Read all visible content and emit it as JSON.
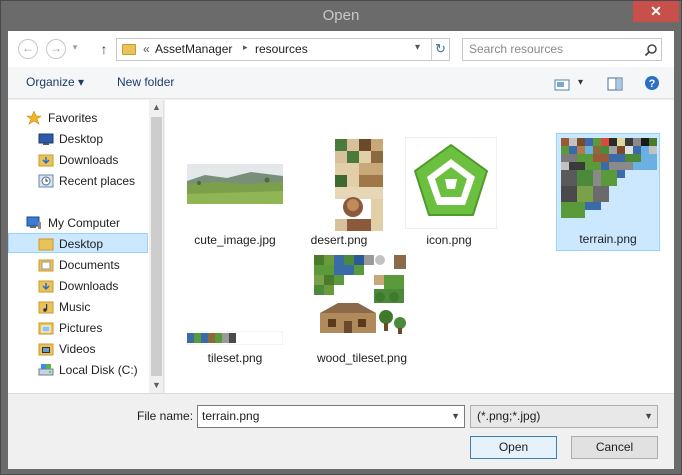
{
  "window": {
    "title": "Open",
    "close_glyph": "✕"
  },
  "nav": {
    "back_glyph": "←",
    "forward_glyph": "→",
    "up_glyph": "↑",
    "breadcrumb": {
      "prefix": "«",
      "parts": [
        "AssetManager",
        "resources"
      ],
      "separator": "▸"
    },
    "refresh_glyph": "↻",
    "search": {
      "placeholder": "Search resources"
    }
  },
  "toolbar": {
    "organize_label": "Organize ▾",
    "new_folder_label": "New folder",
    "view_dropdown": "▾"
  },
  "sidebar": {
    "favorites_label": "Favorites",
    "favorites": [
      "Desktop",
      "Downloads",
      "Recent places"
    ],
    "computer_label": "My Computer",
    "computer": [
      "Desktop",
      "Documents",
      "Downloads",
      "Music",
      "Pictures",
      "Videos",
      "Local Disk (C:)"
    ],
    "selected": "Desktop"
  },
  "files": [
    {
      "name": "cute_image.jpg"
    },
    {
      "name": "desert.png"
    },
    {
      "name": "icon.png"
    },
    {
      "name": "terrain.png",
      "selected": true
    },
    {
      "name": "tileset.png"
    },
    {
      "name": "wood_tileset.png"
    }
  ],
  "footer": {
    "file_name_label": "File name:",
    "file_name_value": "terrain.png",
    "filter_value": "(*.png;*.jpg)",
    "open_label": "Open",
    "cancel_label": "Cancel"
  },
  "colors": {
    "accent": "#cce8ff",
    "accent_border": "#99d1ff",
    "icon_green": "#6cc03f"
  }
}
